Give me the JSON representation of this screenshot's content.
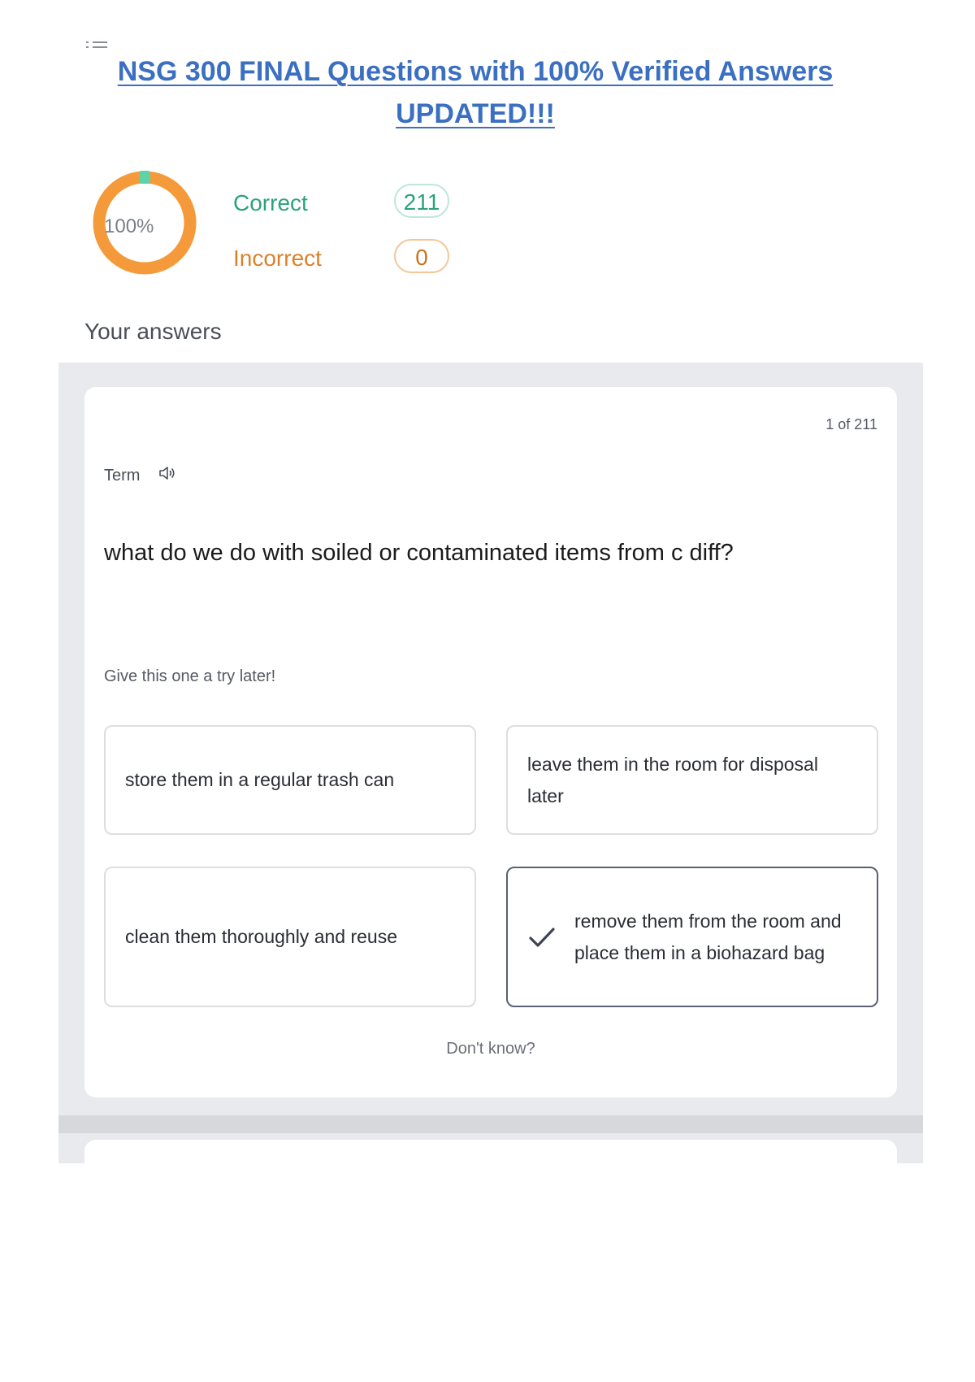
{
  "document": {
    "title": "NSG 300 FINAL Questions with 100% Verified Answers UPDATED!!!"
  },
  "score": {
    "percent_label": "100%",
    "percent_value": 100,
    "correct_label": "Correct",
    "correct_count": "211",
    "incorrect_label": "Incorrect",
    "incorrect_count": "0"
  },
  "answers_section": {
    "title": "Your answers"
  },
  "card": {
    "counter": "1 of 211",
    "term_label": "Term",
    "question": "what do we do with soiled or contaminated items from c diff?",
    "hint": "Give this one a try later!",
    "options": [
      {
        "text": "store them in a regular trash can",
        "selected": false
      },
      {
        "text": "leave them in the room for disposal later",
        "selected": false
      },
      {
        "text": "clean them thoroughly and reuse",
        "selected": false
      },
      {
        "text": "remove them from the room and place them in a biohazard bag",
        "selected": true
      }
    ],
    "dont_know": "Don't know?"
  },
  "colors": {
    "accent_title": "#3a6fc1",
    "correct": "#2aa27a",
    "incorrect": "#d9822b",
    "donut_ring": "#f59a3a",
    "donut_marker": "#5fd3a8"
  },
  "icons": {
    "list": "list-icon",
    "speaker": "speaker-icon",
    "check": "check-icon"
  }
}
